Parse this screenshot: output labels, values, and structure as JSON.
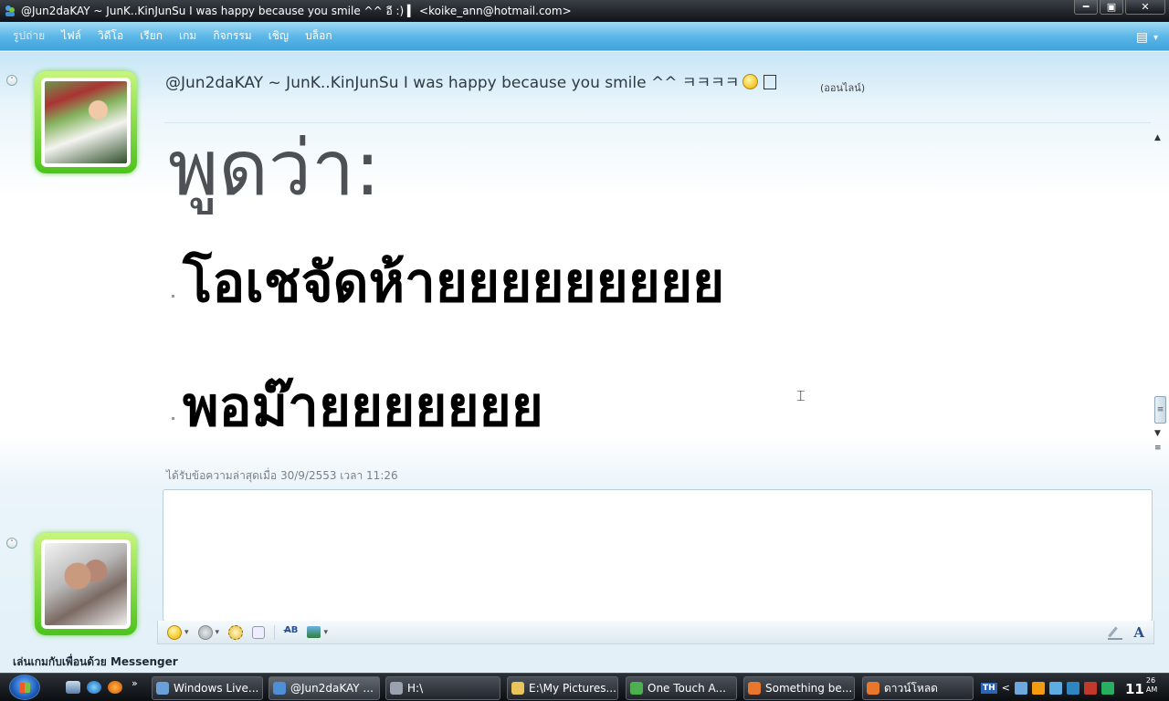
{
  "window": {
    "title": "@Jun2daKAY ~ JunK..KinJunSu I was happy because you smile ^^ อี :) ▍ <koike_ann@hotmail.com>",
    "minimize": "━",
    "maximize": "▣",
    "close": "✕"
  },
  "menu": {
    "items": [
      "รูปถ่าย",
      "ไฟล์",
      "วิดีโอ",
      "เรียก",
      "เกม",
      "กิจกรรม",
      "เชิญ",
      "บล็อก"
    ],
    "options_icon": "▤",
    "options_arrow": "▾"
  },
  "conversation": {
    "collapse_icon": "˅",
    "contact_name": "@Jun2daKAY ~ JunK..KinJunSu I was happy because you smile ^^ ㅋㅋㅋㅋ",
    "contact_status": "(ออนไลน์)",
    "says_label": "พูดว่า:",
    "messages": [
      "โอเชจัดห้ายยยยยยยยย",
      "พอม๊ายยยยยยย"
    ],
    "last_received": "ได้รับข้อความล่าสุดเมื่อ 30/9/2553 เวลา 11:26"
  },
  "scrollbar": {
    "up": "▲",
    "thumb": "≡",
    "down": "▼",
    "end": "≡"
  },
  "compose": {
    "toolbar_arrow": "▾",
    "spell_label": "A̶B",
    "font_label": "A"
  },
  "footer": {
    "games_link": "เล่นเกมกับเพื่อนด้วย Messenger"
  },
  "cursor": "⌶",
  "taskbar": {
    "quicklaunch_more": "»",
    "tasks": [
      {
        "label": "Windows Live...",
        "color": "#6a9fd8"
      },
      {
        "label": "@Jun2daKAY ...",
        "color": "#4f8fd6"
      },
      {
        "label": "H:\\",
        "color": "#9aa3ad"
      },
      {
        "label": "E:\\My Pictures...",
        "color": "#e8c45a"
      },
      {
        "label": "One Touch A...",
        "color": "#4caf50"
      },
      {
        "label": "Something be...",
        "color": "#e8762b"
      },
      {
        "label": "ดาวน์โหลด",
        "color": "#e8762b"
      }
    ],
    "tray": {
      "language": "TH",
      "chevron": "<",
      "icons": [
        "network-icon",
        "media-icon",
        "messenger-tray-icon",
        "bluetooth-icon",
        "security-icon",
        "sync-icon"
      ]
    },
    "clock": {
      "hour": "11",
      "minute": "26",
      "ampm": "AM"
    }
  }
}
